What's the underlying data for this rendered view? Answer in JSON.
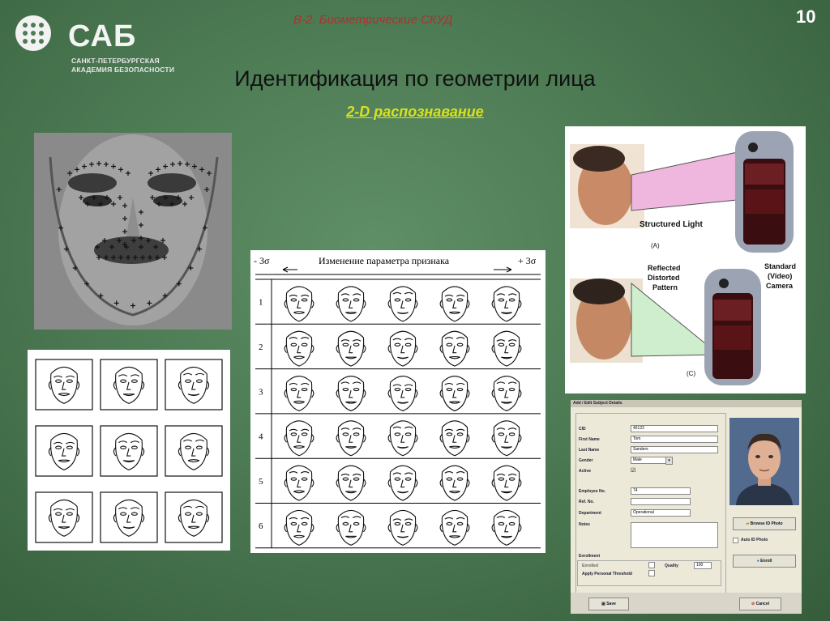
{
  "header": {
    "logo_text": "САБ",
    "logo_subtitle_line1": "САНКТ-ПЕТЕРБУРГСКАЯ",
    "logo_subtitle_line2": "АКАДЕМИЯ БЕЗОПАСНОСТИ",
    "section": "В-2. Биометрические СКУД",
    "slide_number": "10"
  },
  "title": "Идентификация по геометрии лица",
  "subtitle": "2-D распознавание",
  "feature_table": {
    "left_label": "- 3σ",
    "header": "Изменение параметра признака",
    "right_label": "+ 3σ",
    "rows": [
      "1",
      "2",
      "3",
      "4",
      "5",
      "6"
    ]
  },
  "sensor_diagram": {
    "structured_light": "Structured Light",
    "label_a": "(A)",
    "reflected": "Reflected",
    "distorted": "Distorted",
    "pattern": "Pattern",
    "standard": "Standard",
    "video": "(Video)",
    "camera": "Camera",
    "label_c": "(C)"
  },
  "subject_form": {
    "title": "Add / Edit Subject Details",
    "fields": {
      "cid_label": "CID",
      "cid_value": "45122",
      "first_name_label": "First Name",
      "first_name_value": "Tom",
      "last_name_label": "Last Name",
      "last_name_value": "Sanders",
      "gender_label": "Gender",
      "gender_value": "Male",
      "active_label": "Active",
      "active_value": "☑",
      "employee_label": "Employee No.",
      "employee_value": "74",
      "ref_label": "Ref. No.",
      "ref_value": "",
      "department_label": "Department",
      "department_value": "Operational",
      "notes_label": "Notes"
    },
    "enrollment_label": "Enrollment",
    "enrolled_label": "Enrolled",
    "quality_label": "Quality",
    "quality_value": "100",
    "threshold_label": "Apply Personal Threshold",
    "browse_button": "Browse ID Photo",
    "auto_id_label": "Auto ID Photo",
    "enroll_button": "Enroll",
    "save_button": "Save",
    "cancel_button": "Cancel"
  }
}
